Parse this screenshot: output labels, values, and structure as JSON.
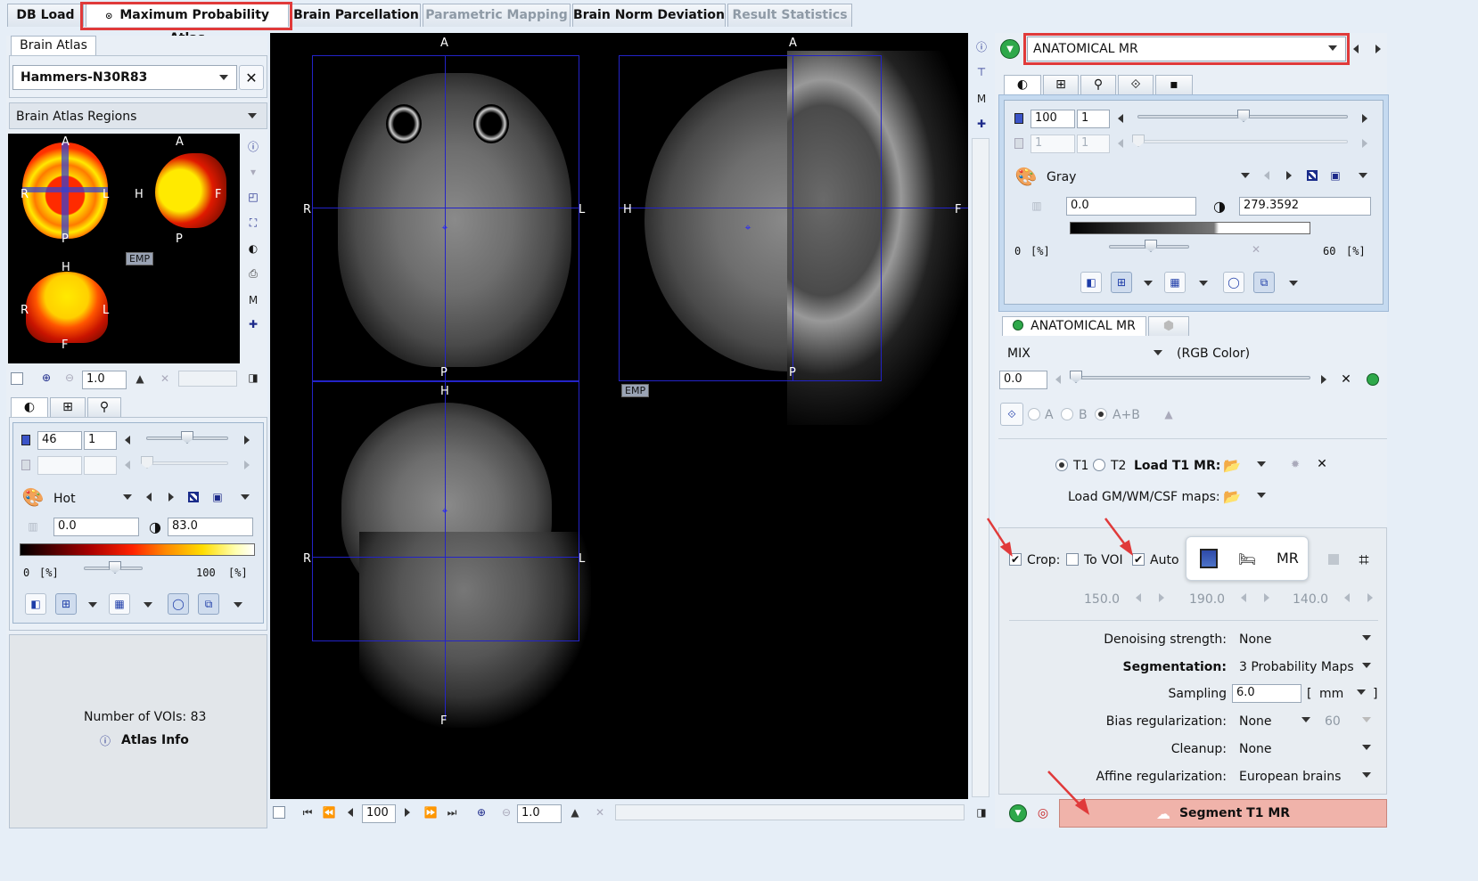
{
  "tabs": [
    {
      "label": "DB Load",
      "state": "normal"
    },
    {
      "label": "Maximum Probability Atlas",
      "state": "active"
    },
    {
      "label": "Brain Parcellation",
      "state": "normal"
    },
    {
      "label": "Parametric Mapping",
      "state": "disabled"
    },
    {
      "label": "Brain Norm Deviation",
      "state": "normal"
    },
    {
      "label": "Result Statistics",
      "state": "disabled"
    }
  ],
  "left": {
    "atlas_tab": "Brain Atlas",
    "atlas_name": "Hammers-N30R83",
    "regions_label": "Brain Atlas Regions",
    "overview_labels": {
      "a": "A",
      "p": "P",
      "r": "R",
      "l": "L",
      "h": "H",
      "f": "F",
      "emp": "EMP"
    },
    "zoom_value": "1.0",
    "lut": {
      "value1": "46",
      "value2": "1",
      "palette": "Hot",
      "min": "0.0",
      "max": "83.0",
      "scale_min": "0",
      "scale_max": "100",
      "percent": "[%]"
    },
    "num_vois": "Number of VOIs: 83",
    "atlas_info": "Atlas Info"
  },
  "viewer": {
    "labels": {
      "a": "A",
      "p": "P",
      "r": "R",
      "l": "L",
      "h": "H",
      "f": "F",
      "emp": "EMP"
    },
    "frame_value": "100",
    "zoom_value": "1.0"
  },
  "right": {
    "series": "ANATOMICAL MR",
    "lut": {
      "value1": "100",
      "value2": "1",
      "dis1": "1",
      "dis2": "1",
      "palette": "Gray",
      "min": "0.0",
      "max": "279.3592",
      "scale_min": "0",
      "scale_max": "60",
      "percent": "[%]"
    },
    "layer_tab": "ANATOMICAL MR",
    "mix_label": "MIX",
    "rgb_label": "(RGB Color)",
    "mix_value": "0.0",
    "radio_a": "A",
    "radio_b": "B",
    "radio_ab": "A+B",
    "t1": "T1",
    "t2": "T2",
    "load_t1": "Load T1 MR:",
    "load_maps": "Load GM/WM/CSF maps:",
    "crop": "Crop:",
    "to_voi": "To VOI",
    "auto": "Auto",
    "crop_values": [
      "150.0",
      "190.0",
      "140.0"
    ],
    "mr_icon_text": "MR",
    "params": [
      {
        "label": "Denoising strength:",
        "value": "None",
        "bold": false
      },
      {
        "label": "Segmentation:",
        "value": "3 Probability Maps",
        "bold": true
      },
      {
        "label": "Sampling",
        "value": "6.0",
        "bold": false
      },
      {
        "label": "Bias regularization:",
        "value": "None",
        "bold": false
      },
      {
        "label": "Cleanup:",
        "value": "None",
        "bold": false
      },
      {
        "label": "Affine regularization:",
        "value": "European brains",
        "bold": false
      }
    ],
    "sampling_unit": "mm",
    "bias_extra": "60",
    "segment_button": "Segment T1 MR"
  },
  "colors": {
    "accent_red": "#e03a3a",
    "segment_bg": "#f0b3aa",
    "overlay_blue": "#2323c8"
  }
}
